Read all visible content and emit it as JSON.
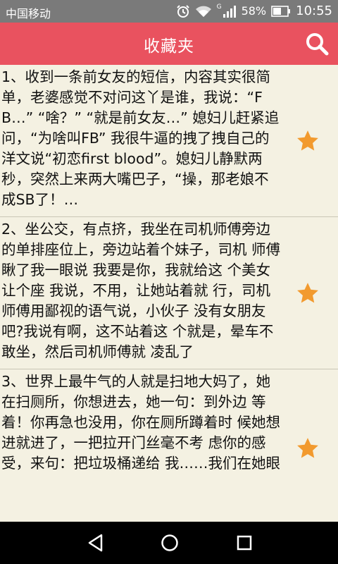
{
  "status_bar": {
    "carrier": "中国移动",
    "battery": "58%",
    "time": "10:55",
    "network": "G",
    "icons": [
      "alarm-icon",
      "wifi-icon",
      "signal-icon",
      "battery-icon"
    ]
  },
  "app_bar": {
    "title": "收藏夹",
    "search_icon": "search-icon",
    "color": "#e9525f"
  },
  "favorites": [
    {
      "text": "1、收到一条前女友的短信，内容其实很简单，老婆感觉不对问这丫是谁，我说：“FB…” “啥？” “就是前女友…” 媳妇儿赶紧追问，“为啥叫FB” 我很牛逼的拽了拽自己的洋文说“初恋first blood”。媳妇儿静默两秒，突然上来两大嘴巴子，“操，那老娘不成SB了！…",
      "icon": "star-icon",
      "starred": true
    },
    {
      "text": "2、坐公交，有点挤，我坐在司机师傅旁边 的单排座位上，旁边站着个妹子，司机 师傅瞅了我一眼说 我要是你，我就给这 个美女让个座 我说，不用，让她站着就 行，司机师傅用鄙视的语气说，小伙子 没有女朋友吧?我说有啊，这不站着这 个就是，晕车不敢坐，然后司机师傅就 凌乱了",
      "icon": "star-icon",
      "starred": true
    },
    {
      "text": "3、世界上最牛气的人就是扫地大妈了，她 在扫厕所，你想进去，她一句：到外边 等着！你再急也没用，你在厕所蹲着时 候她想进就进了，一把拉开门丝毫不考 虑你的感受，来句：把垃圾桶递给 我……我们在她眼",
      "icon": "star-icon",
      "starred": true
    }
  ],
  "nav_bar": {
    "icons": [
      "back-icon",
      "home-icon",
      "recents-icon"
    ]
  },
  "colors": {
    "star": "#f29a2e",
    "background": "#f4f1e2",
    "status_bar": "#7a7a7a"
  }
}
